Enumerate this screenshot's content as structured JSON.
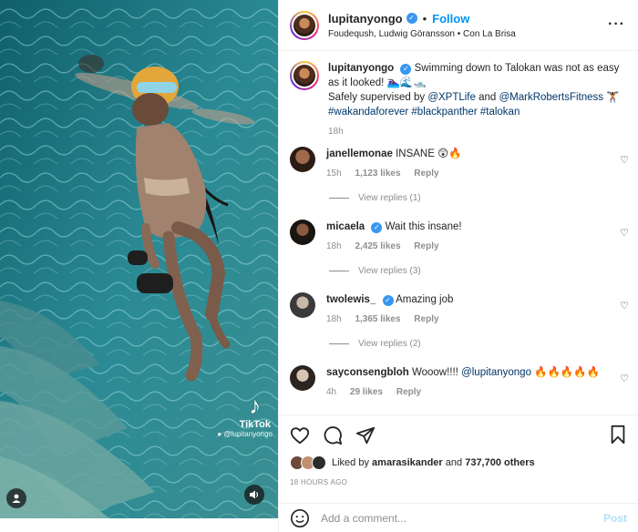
{
  "post": {
    "author": "lupitanyongo",
    "follow_label": "Follow",
    "dot": "•",
    "audio": "Foudeqush, Ludwig Göransson • Con La Brisa",
    "more_icon": "more-horizontal-icon"
  },
  "caption": {
    "username": "lupitanyongo",
    "text_1": "Swimming down to Talokan was not as easy as it looked! 🏊🏿‍♀️🌊🛥️",
    "text_2a": "Safely supervised by ",
    "mention_1": "@XPTLife",
    "and": " and ",
    "mention_2": "@MarkRobertsFitness",
    "text_2b": " 🏋🏿",
    "hashtags": "#wakandaforever #blackpanther #talokan",
    "time": "18h"
  },
  "comments": [
    {
      "username": "janellemonae",
      "verified": false,
      "text": "INSANE 😲🔥",
      "time": "15h",
      "likes": "1,123 likes",
      "reply": "Reply",
      "view_replies": "View replies (1)"
    },
    {
      "username": "micaela",
      "verified": true,
      "text": "Wait this insane!",
      "time": "18h",
      "likes": "2,425 likes",
      "reply": "Reply",
      "view_replies": "View replies (3)"
    },
    {
      "username": "twolewis_",
      "verified": true,
      "text": "Amazing job",
      "time": "18h",
      "likes": "1,365 likes",
      "reply": "Reply",
      "view_replies": "View replies (2)"
    },
    {
      "username": "sayconsengbloh",
      "verified": false,
      "text_prefix": "Wooow!!!! ",
      "mention": "@lupitanyongo",
      "text_suffix": " 🔥🔥🔥🔥🔥",
      "time": "4h",
      "likes": "29 likes",
      "reply": "Reply"
    }
  ],
  "likes": {
    "prefix": "Liked by ",
    "user": "amarasikander",
    "and": " and ",
    "count": "737,700 others"
  },
  "posted_ago": "18 HOURS AGO",
  "add_comment": {
    "placeholder": "Add a comment...",
    "post_label": "Post"
  },
  "video": {
    "tiktok_word": "TikTok",
    "tiktok_handle": "@lupitanyongo"
  },
  "colors": {
    "accent": "#0095f6",
    "link": "#00376b",
    "muted": "#8e8e8e",
    "verified": "#3897f0",
    "water": "#1d6c75"
  }
}
